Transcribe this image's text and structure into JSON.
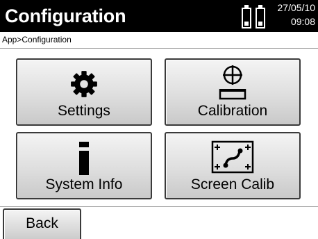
{
  "header": {
    "title": "Configuration",
    "date": "27/05/10",
    "time": "09:08",
    "battery_icons": [
      "battery-icon",
      "battery-icon"
    ]
  },
  "breadcrumb": "App>Configuration",
  "tiles": [
    {
      "label": "Settings",
      "icon": "gear-icon"
    },
    {
      "label": "Calibration",
      "icon": "calibration-icon"
    },
    {
      "label": "System Info",
      "icon": "info-icon"
    },
    {
      "label": "Screen Calib",
      "icon": "screen-calibration-icon"
    }
  ],
  "footer": {
    "back_label": "Back"
  },
  "colors": {
    "titlebar": "#000000",
    "tile_top": "#f4f4f4",
    "tile_bottom": "#c9c9c9",
    "border": "#3a3a3a"
  }
}
